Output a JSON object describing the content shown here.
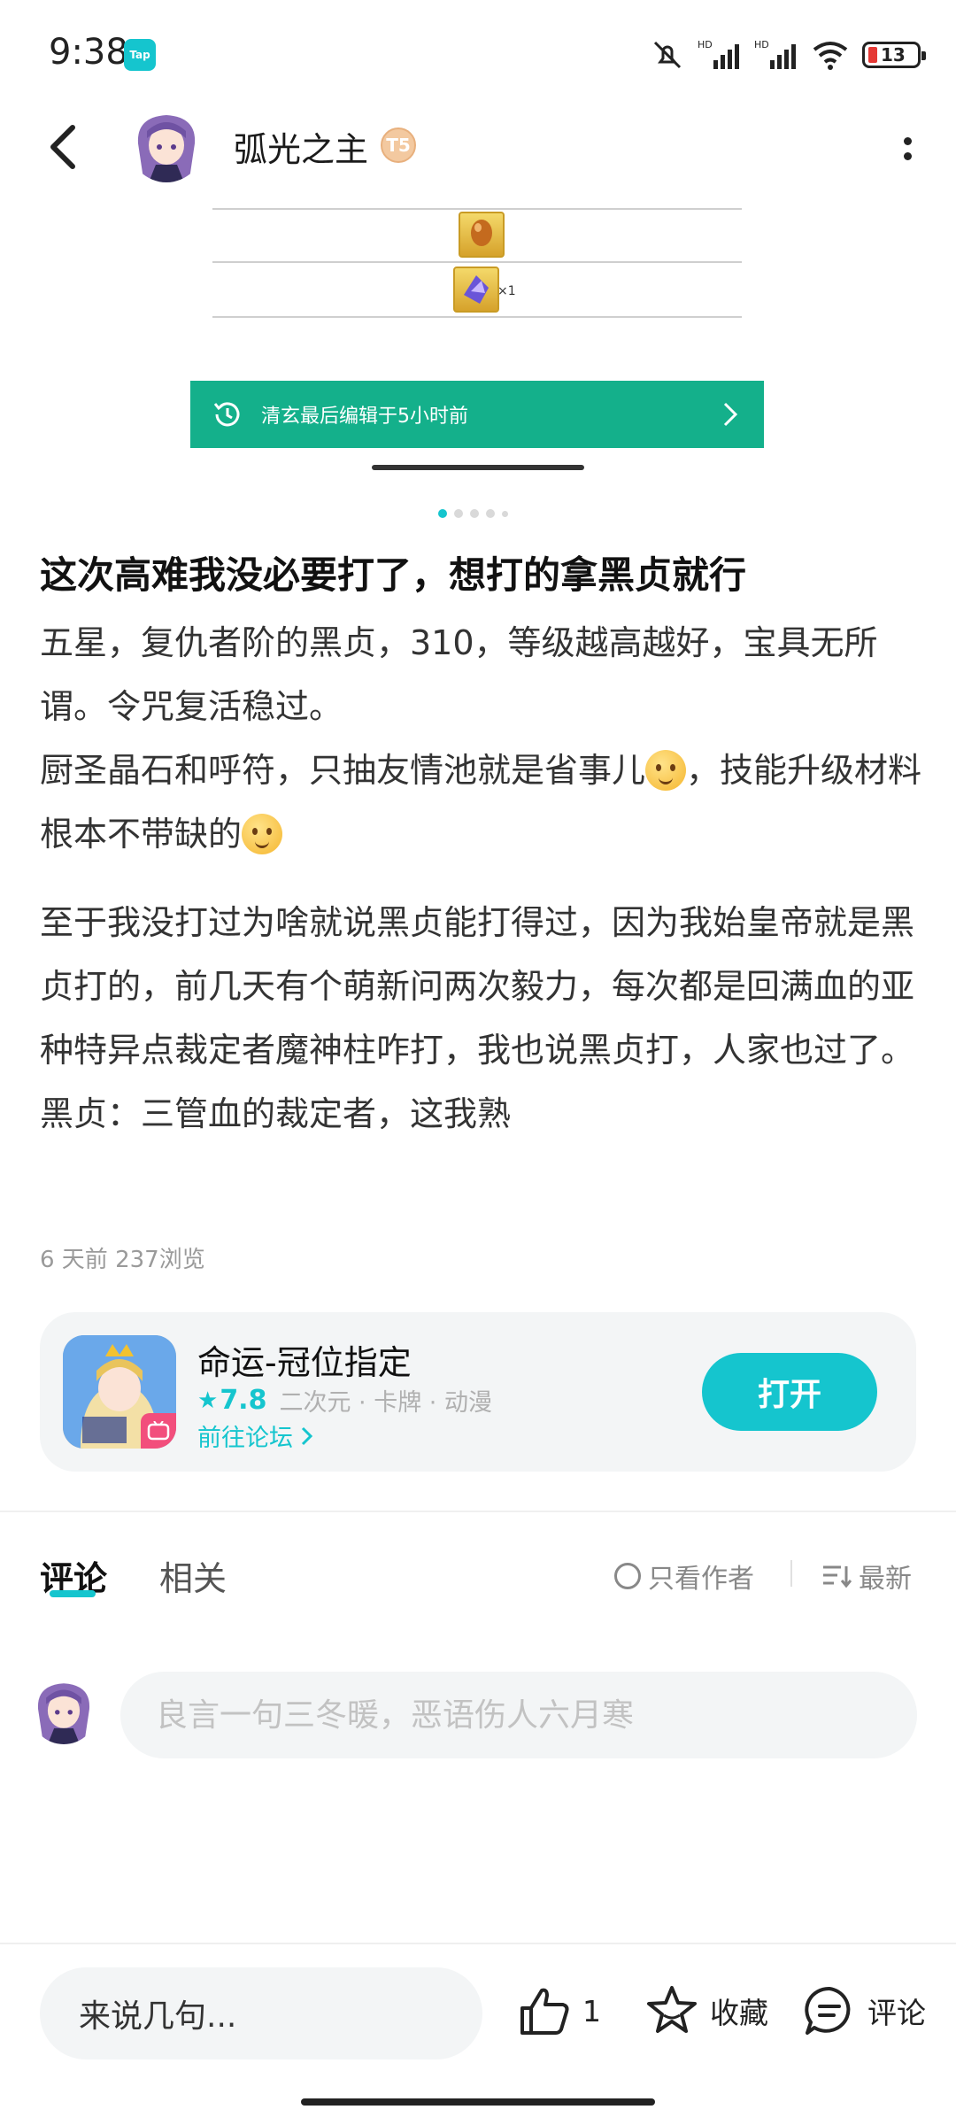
{
  "status_bar": {
    "time": "9:38",
    "app_badge": "Tap",
    "battery_level": "13",
    "icons": [
      "bell-muted-icon",
      "hd-signal-icon",
      "hd-signal-icon",
      "wifi-icon",
      "battery-icon"
    ]
  },
  "header": {
    "author_name": "弧光之主",
    "level_badge": "T5",
    "icons": [
      "back-arrow-icon",
      "more-vert-icon"
    ]
  },
  "carousel": {
    "item_quantity": "×1",
    "edit_notice": "清玄最后编辑于5小时前",
    "dots": 5,
    "active_dot": 0
  },
  "post": {
    "title": "这次高难我没必要打了，想打的拿黑贞就行",
    "para1": "五星，复仇者阶的黑贞，310，等级越高越好，宝具无所谓。令咒复活稳过。",
    "para2a": "厨圣晶石和呼符，只抽友情池就是省事儿",
    "para2b": "，技能升级材料根本不带缺的",
    "para3": "至于我没打过为啥就说黑贞能打得过，因为我始皇帝就是黑贞打的，前几天有个萌新问两次毅力，每次都是回满血的亚种特异点裁定者魔神柱咋打，我也说黑贞打，人家也过了。",
    "para4": "黑贞：三管血的裁定者，这我熟",
    "meta": "6 天前  237浏览"
  },
  "game_card": {
    "name": "命运-冠位指定",
    "rating": "7.8",
    "tags": "二次元 · 卡牌 · 动漫",
    "forum_link": "前往论坛",
    "open_label": "打开"
  },
  "comments": {
    "tab_comment": "评论",
    "tab_related": "相关",
    "author_only": "只看作者",
    "sort": "最新",
    "input_placeholder": "良言一句三冬暖，恶语伤人六月寒"
  },
  "bottom_bar": {
    "say_placeholder": "来说几句...",
    "like_count": "1",
    "favorite_label": "收藏",
    "comment_label": "评论"
  },
  "colors": {
    "accent": "#15c5ce",
    "banner_green": "#14b08b",
    "text": "#1a1a1a",
    "muted": "#9a9a9a"
  }
}
